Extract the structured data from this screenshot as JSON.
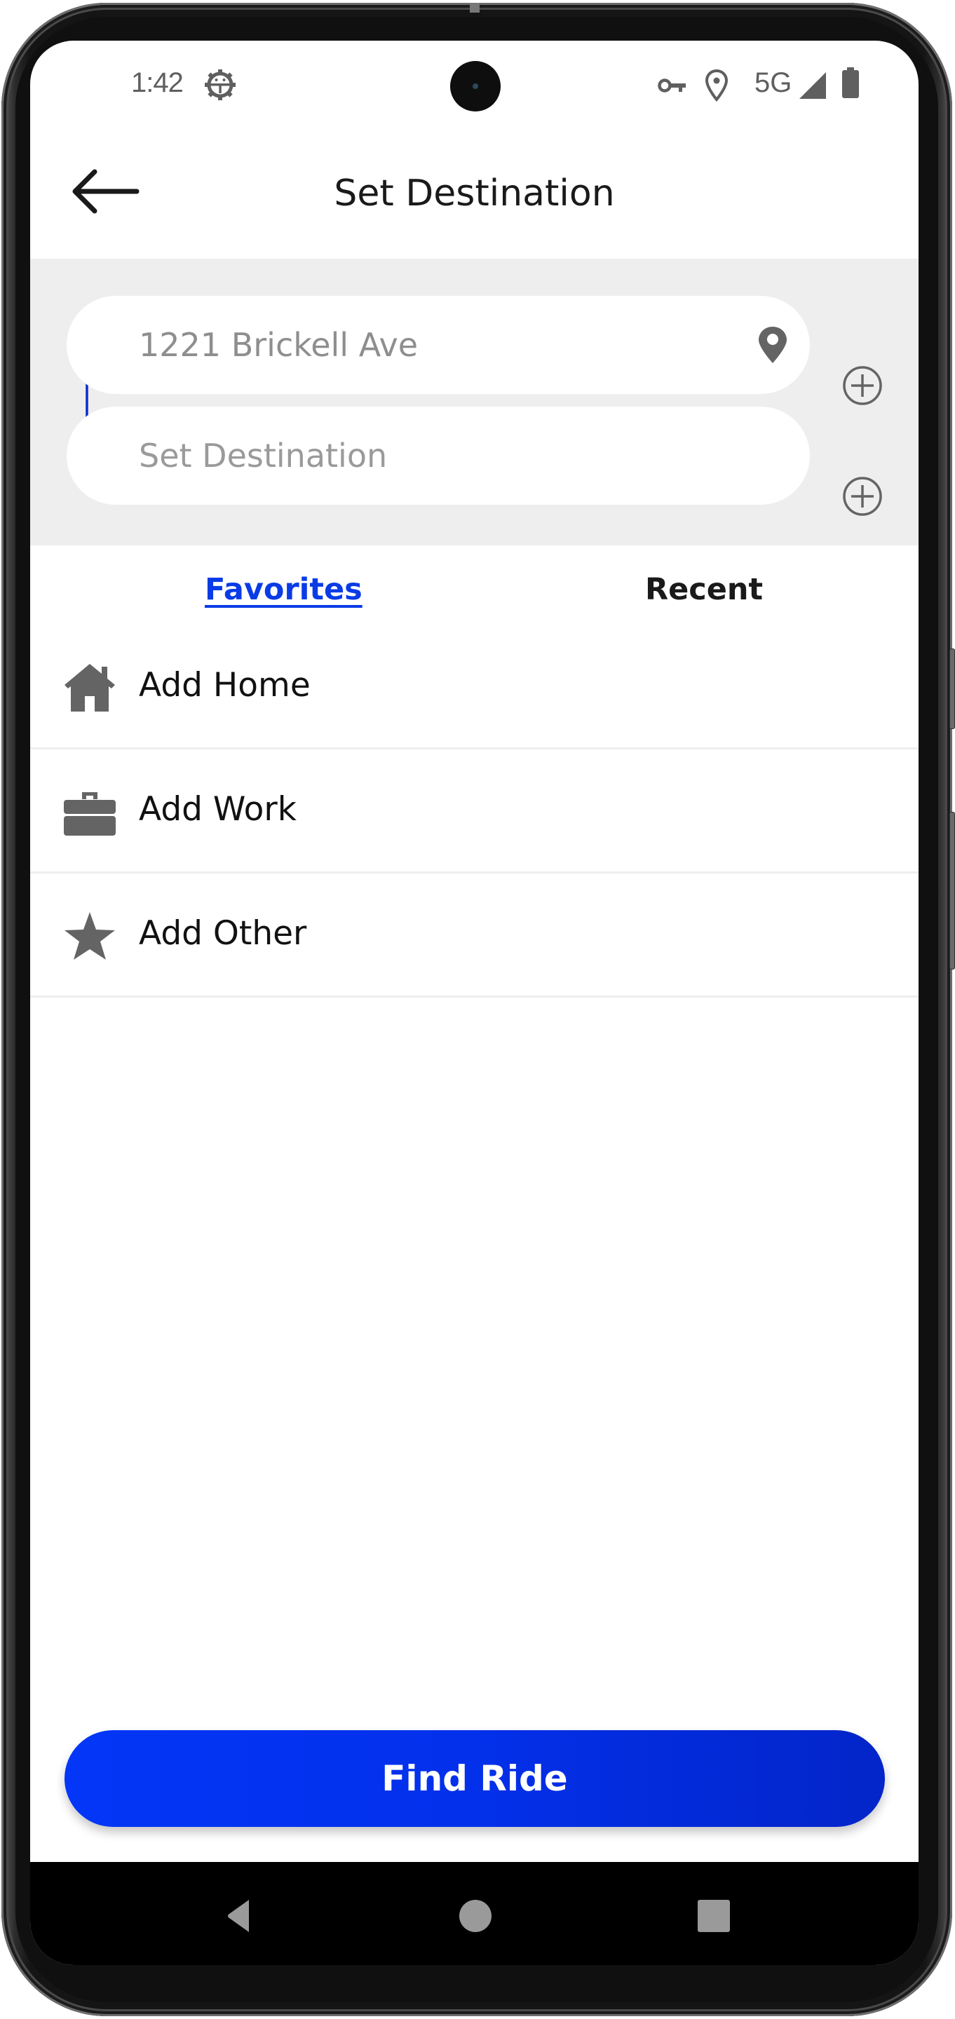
{
  "status_bar": {
    "time": "1:42",
    "network": "5G",
    "left_icons": [
      "android-debug-icon"
    ],
    "right_icons": [
      "vpn-key-icon",
      "location-icon",
      "signal-icon",
      "battery-icon"
    ]
  },
  "header": {
    "title": "Set Destination",
    "back_icon": "arrow-left-icon"
  },
  "route": {
    "pickup": {
      "value": "1221 Brickell Ave",
      "icon": "map-pin-icon",
      "add_icon": "plus-circle-icon"
    },
    "destination": {
      "value": "",
      "placeholder": "Set Destination",
      "add_icon": "plus-circle-icon"
    },
    "connector_color": "#0a2bd0"
  },
  "tabs": [
    {
      "label": "Favorites",
      "active": true
    },
    {
      "label": "Recent",
      "active": false
    }
  ],
  "favorites": [
    {
      "label": "Add Home",
      "icon": "home-icon"
    },
    {
      "label": "Add Work",
      "icon": "briefcase-icon"
    },
    {
      "label": "Add Other",
      "icon": "star-icon"
    }
  ],
  "primary_action": {
    "label": "Find Ride",
    "color": "#0336f5"
  },
  "nav_bar": {
    "buttons": [
      "back-triangle-icon",
      "home-circle-icon",
      "recents-square-icon"
    ]
  },
  "colors": {
    "accent": "#0a3be6",
    "panel_bg": "#eeeeee",
    "icon_gray": "#646464"
  }
}
